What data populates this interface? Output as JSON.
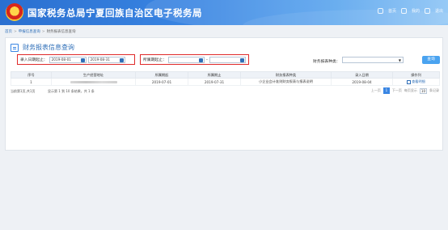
{
  "header": {
    "title": "国家税务总局宁夏回族自治区电子税务局",
    "links": [
      "首页",
      "我的",
      "退出"
    ]
  },
  "breadcrumb": {
    "home": "首页",
    "parent": "申报信息查询",
    "current": "财务报表信息查询"
  },
  "page": {
    "title": "财务报表信息查询"
  },
  "filters": {
    "entry_date_label": "录入日期起止：",
    "entry_date_from": "2019-08-01",
    "entry_date_to": "2019-08-31",
    "period_label": "所属期起止：",
    "period_from": "",
    "period_to": "",
    "type_label": "财务报表种类：",
    "type_value": "",
    "query_button": "查询"
  },
  "table": {
    "columns": [
      "序号",
      "生产经营地址",
      "所属期起",
      "所属期止",
      "财务报表种类",
      "录入日期",
      "操作列"
    ],
    "rows": [
      {
        "index": "1",
        "address": "",
        "period_start": "2019-07-01",
        "period_end": "2019-07-31",
        "report_type": "小企业会计准则财务报表与报表说明",
        "entry_date": "2019-08-04",
        "action": "查看明细"
      }
    ]
  },
  "pagination": {
    "summary_left": "当前第1页,共1页",
    "summary_mid": "显示第 1 到 10 条结果，共 1 条",
    "prev": "上一页",
    "current": "1",
    "next": "下一页",
    "size_label": "每页显示",
    "page_size": "10",
    "size_unit": "条记录"
  },
  "colors": {
    "accent": "#3a86e3",
    "highlight_border": "#e02a2a"
  }
}
